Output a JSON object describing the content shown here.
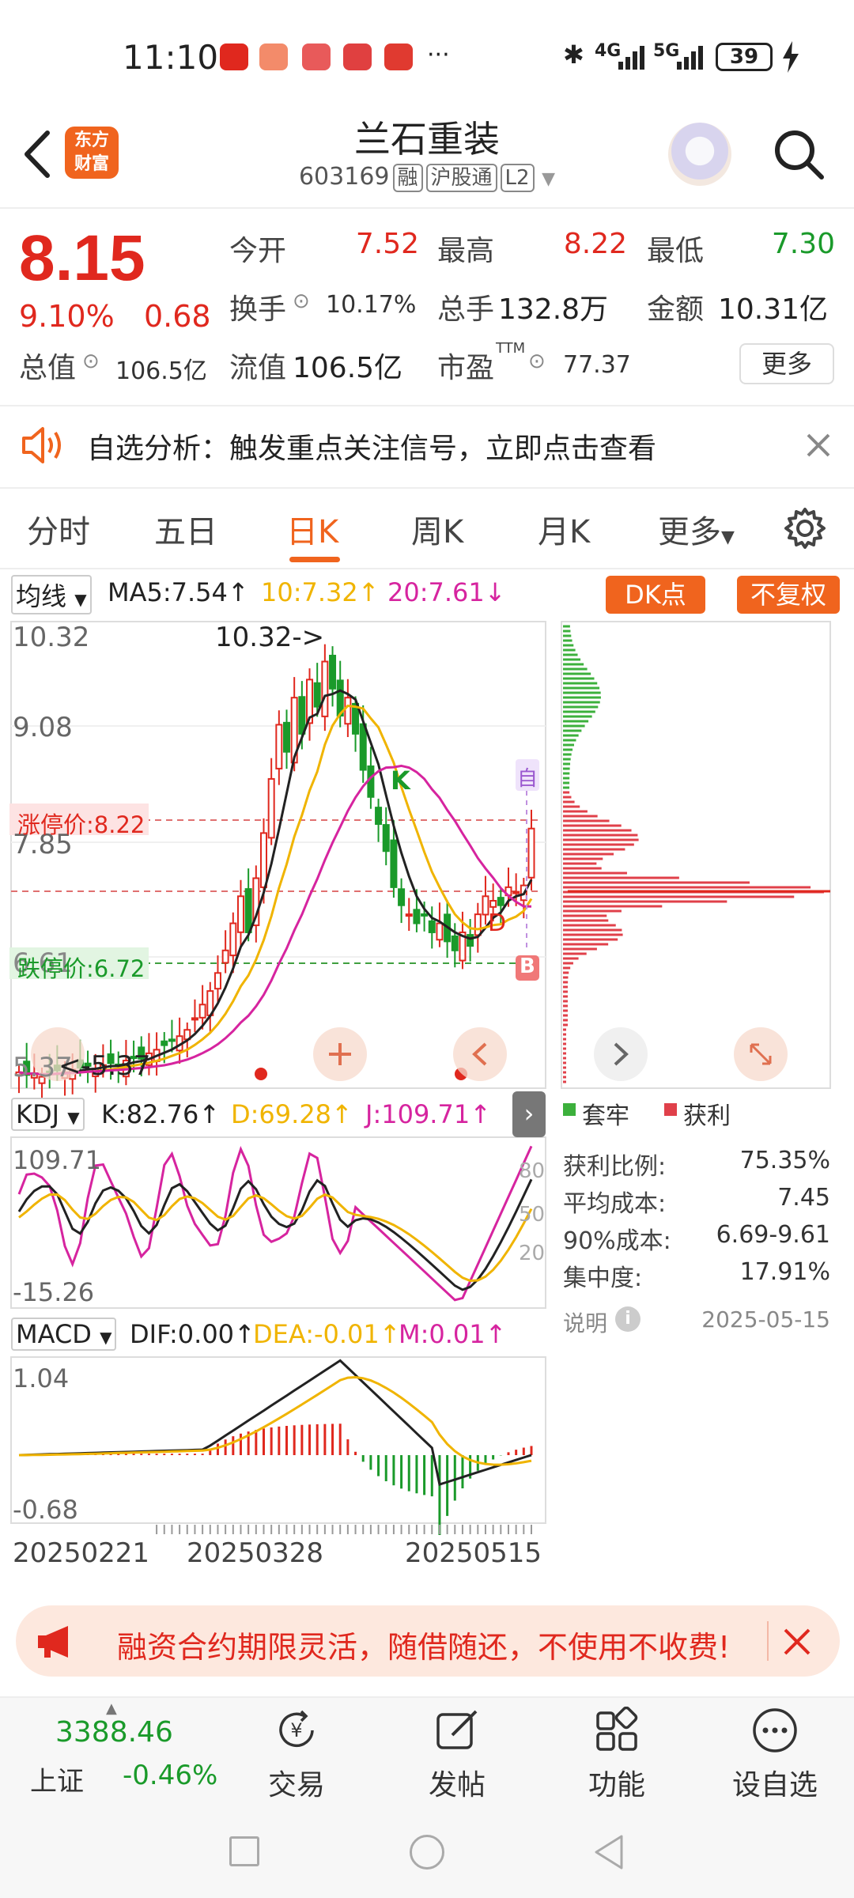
{
  "status": {
    "time": "11:10",
    "net1": "4G",
    "net2": "5G",
    "battery": "39"
  },
  "header": {
    "logo_line1": "东方",
    "logo_line2": "财富",
    "stock_name": "兰石重装",
    "stock_code": "603169",
    "tag1": "融",
    "tag2": "沪股通",
    "tag3": "L2"
  },
  "quote": {
    "price": "8.15",
    "change_pct": "9.10%",
    "change_abs": "0.68",
    "open_label": "今开",
    "open_value": "7.52",
    "high_label": "最高",
    "high_value": "8.22",
    "low_label": "最低",
    "low_value": "7.30",
    "turnover_label": "换手",
    "turnover_value": "10.17%",
    "volume_label": "总手",
    "volume_value": "132.8万",
    "amount_label": "金额",
    "amount_value": "10.31亿",
    "mktcap_label": "总值",
    "mktcap_value": "106.5亿",
    "float_label": "流值",
    "float_value": "106.5亿",
    "pe_label": "市盈",
    "pe_sup": "TTM",
    "pe_value": "77.37",
    "more_label": "更多"
  },
  "alert": {
    "text": "自选分析：触发重点关注信号，立即点击查看"
  },
  "tabs": [
    "分时",
    "五日",
    "日K",
    "周K",
    "月K",
    "更多"
  ],
  "active_tab": "日K",
  "kline_legend": {
    "ma_dropdown": "均线",
    "ma5": "MA5:7.54",
    "ma10": "10:7.32",
    "ma20": "20:7.61",
    "dk_button": "DK点",
    "adjust_button": "不复权"
  },
  "chart_labels": {
    "y_top": "10.32",
    "y_mid1": "9.08",
    "y_mid2": "7.85",
    "y_low": "6.61",
    "y_bottom": "5.37",
    "max_marker": "10.32->",
    "min_marker": "<-5.37",
    "limit_up": "涨停价:8.22",
    "limit_down": "跌停价:6.72",
    "k_marker": "K",
    "d_marker": "D",
    "b_marker": "B",
    "self_marker": "自"
  },
  "kdj": {
    "dropdown": "KDJ",
    "k": "K:82.76",
    "d": "D:69.28",
    "j": "J:109.71",
    "y_top": "109.71",
    "y_bottom": "-15.26",
    "level80": "80",
    "level50": "50",
    "level20": "20"
  },
  "macd": {
    "dropdown": "MACD",
    "dif": "DIF:0.00",
    "dea": "DEA:-0.01",
    "m": "M:0.01",
    "y_top": "1.04",
    "y_bottom": "-0.68"
  },
  "x_axis": [
    "20250221",
    "20250328",
    "20250515"
  ],
  "chips": {
    "legend_trapped": "套牢",
    "legend_profit": "获利",
    "rows": [
      {
        "label": "获利比例:",
        "value": "75.35%"
      },
      {
        "label": "平均成本:",
        "value": "7.45"
      },
      {
        "label": "90%成本:",
        "value": "6.69-9.61"
      },
      {
        "label": "集中度:",
        "value": "17.91%"
      }
    ],
    "note_label": "说明",
    "date": "2025-05-15"
  },
  "promo": {
    "text": "融资合约期限灵活，随借随还，不使用不收费!"
  },
  "bottom_nav": {
    "index_value": "3388.46",
    "index_name": "上证",
    "index_change": "-0.46%",
    "trade": "交易",
    "post": "发帖",
    "function": "功能",
    "add_watch": "设自选"
  },
  "colors": {
    "accent": "#f0641e",
    "up": "#e0281e",
    "down": "#1a9a2a",
    "ma10": "#f0b400",
    "ma20": "#d6249f"
  }
}
